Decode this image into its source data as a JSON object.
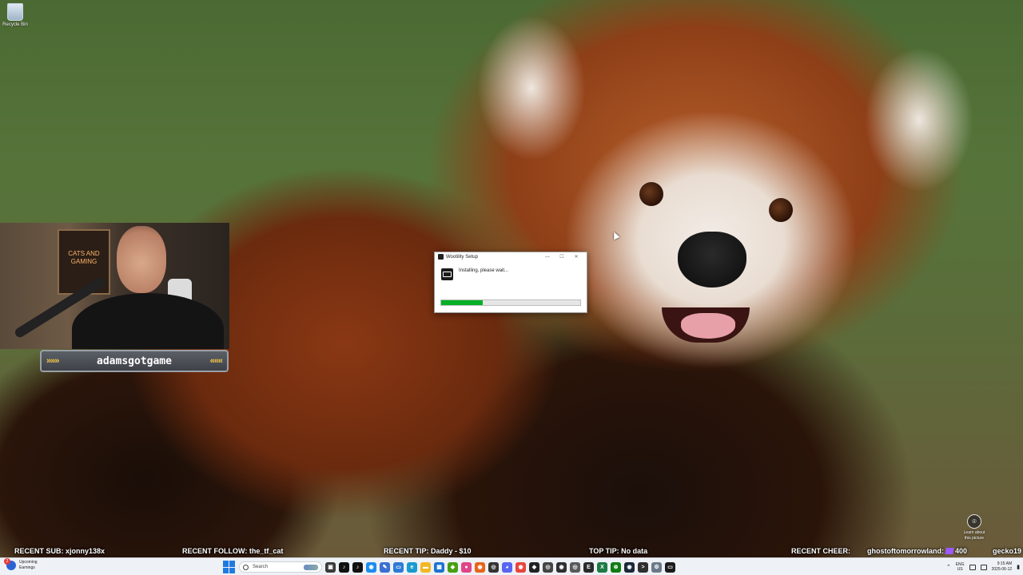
{
  "desktop": {
    "icons": [
      {
        "label": "Recycle Bin",
        "icon": "recycle-bin-icon"
      }
    ]
  },
  "webcam": {
    "nameplate": "adamsgotgame",
    "chevrons_left": "»»»",
    "chevrons_right": "«««",
    "poster_text": "CATS AND GAMING"
  },
  "dialog": {
    "title": "Wootility Setup",
    "status": "Installing, please wait...",
    "progress": 0.3,
    "controls": {
      "minimize": "—",
      "maximize": "☐",
      "close": "✕"
    }
  },
  "wallpaper_info": {
    "learn_icon": "camera-icon",
    "learn_line1": "Learn about",
    "learn_line2": "this picture"
  },
  "ticker": {
    "recent_sub": "RECENT SUB: xjonny138x",
    "recent_follow": "RECENT FOLLOW:   the_tf_cat",
    "recent_tip": "RECENT TIP:  Daddy - $10",
    "top_tip": "TOP TIP: No data",
    "recent_cheer": "RECENT CHEER:",
    "cheer_user": "ghostoftomorrowland:",
    "cheer_amount": "400",
    "cheer_next": "gecko19"
  },
  "taskbar": {
    "widget": {
      "badge": "2",
      "line1": "Upcoming",
      "line2": "Earnings"
    },
    "search_placeholder": "Search",
    "apps": [
      {
        "name": "task-view-icon",
        "color": "#3a3a3a",
        "glyph": "▣"
      },
      {
        "name": "tiktok-icon",
        "color": "#111111",
        "glyph": "♪"
      },
      {
        "name": "tiktok-live-icon",
        "color": "#111111",
        "glyph": "♪"
      },
      {
        "name": "app-blue-icon",
        "color": "#1d8cf0",
        "glyph": "◉"
      },
      {
        "name": "notepad-icon",
        "color": "#3b6fd1",
        "glyph": "✎"
      },
      {
        "name": "remote-desktop-icon",
        "color": "#2c7ad6",
        "glyph": "▭"
      },
      {
        "name": "edge-icon",
        "color": "#1b9ad0",
        "glyph": "e"
      },
      {
        "name": "file-explorer-icon",
        "color": "#f2b824",
        "glyph": "▬"
      },
      {
        "name": "calendar-icon",
        "color": "#1a74d2",
        "glyph": "▦"
      },
      {
        "name": "nvidia-icon",
        "color": "#46a012",
        "glyph": "◆"
      },
      {
        "name": "app-pink-icon",
        "color": "#e0458a",
        "glyph": "●"
      },
      {
        "name": "firefox-icon",
        "color": "#e8641b",
        "glyph": "◉"
      },
      {
        "name": "app-dark-icon",
        "color": "#333333",
        "glyph": "◎"
      },
      {
        "name": "discord-icon",
        "color": "#5865f2",
        "glyph": "◕"
      },
      {
        "name": "chrome-icon",
        "color": "#e8453c",
        "glyph": "◉"
      },
      {
        "name": "app-black-icon",
        "color": "#222222",
        "glyph": "◆"
      },
      {
        "name": "app-circle-icon",
        "color": "#444444",
        "glyph": "◎"
      },
      {
        "name": "obs-icon",
        "color": "#302e31",
        "glyph": "◉"
      },
      {
        "name": "app-gray-icon",
        "color": "#5a5a5a",
        "glyph": "◎"
      },
      {
        "name": "epic-games-icon",
        "color": "#2a2a2a",
        "glyph": "E"
      },
      {
        "name": "excel-icon",
        "color": "#1d7a44",
        "glyph": "X"
      },
      {
        "name": "xbox-icon",
        "color": "#107c10",
        "glyph": "⊗"
      },
      {
        "name": "steam-icon",
        "color": "#1b2838",
        "glyph": "◉"
      },
      {
        "name": "terminal-icon",
        "color": "#2f2f2f",
        "glyph": ">"
      },
      {
        "name": "settings-icon",
        "color": "#6b7a8a",
        "glyph": "⚙"
      },
      {
        "name": "wootility-icon",
        "color": "#1b1b1b",
        "glyph": "▭"
      }
    ],
    "tray": {
      "chevron": "⌃",
      "lang1": "ENG",
      "lang2": "US",
      "time": "9:15 AM",
      "date": "2025-06-12"
    }
  }
}
